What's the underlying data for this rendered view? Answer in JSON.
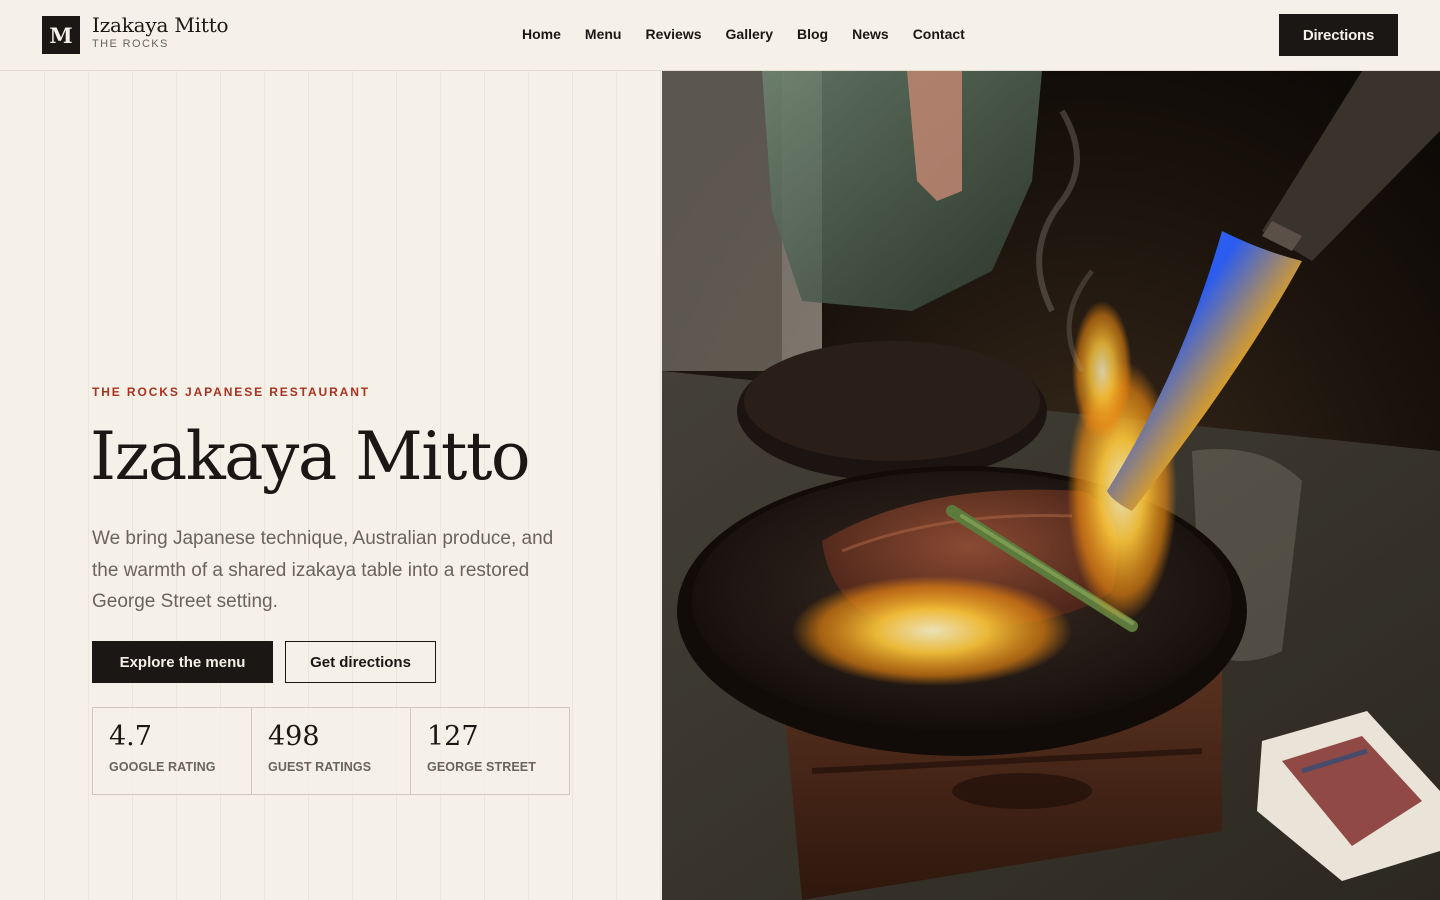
{
  "header": {
    "logo_letter": "M",
    "brand_name": "Izakaya Mitto",
    "brand_sub": "THE ROCKS",
    "nav": [
      {
        "label": "Home"
      },
      {
        "label": "Menu"
      },
      {
        "label": "Reviews"
      },
      {
        "label": "Gallery"
      },
      {
        "label": "Blog"
      },
      {
        "label": "News"
      },
      {
        "label": "Contact"
      }
    ],
    "cta_label": "Directions"
  },
  "hero": {
    "eyebrow": "THE ROCKS JAPANESE RESTAURANT",
    "title": "Izakaya Mitto",
    "description": "We bring Japanese technique, Australian produce, and the warmth of a shared izakaya table into a restored George Street setting.",
    "primary_button": "Explore the menu",
    "secondary_button": "Get directions",
    "stats": [
      {
        "value": "4.7",
        "label": "GOOGLE RATING"
      },
      {
        "value": "498",
        "label": "GUEST RATINGS"
      },
      {
        "value": "127",
        "label": "GEORGE STREET"
      }
    ],
    "image_icon": "photo-flambe-wagyu"
  },
  "colors": {
    "background": "#f5f1e8",
    "ink": "#1a1714",
    "accent": "#a8321f",
    "muted": "#6a645b"
  }
}
